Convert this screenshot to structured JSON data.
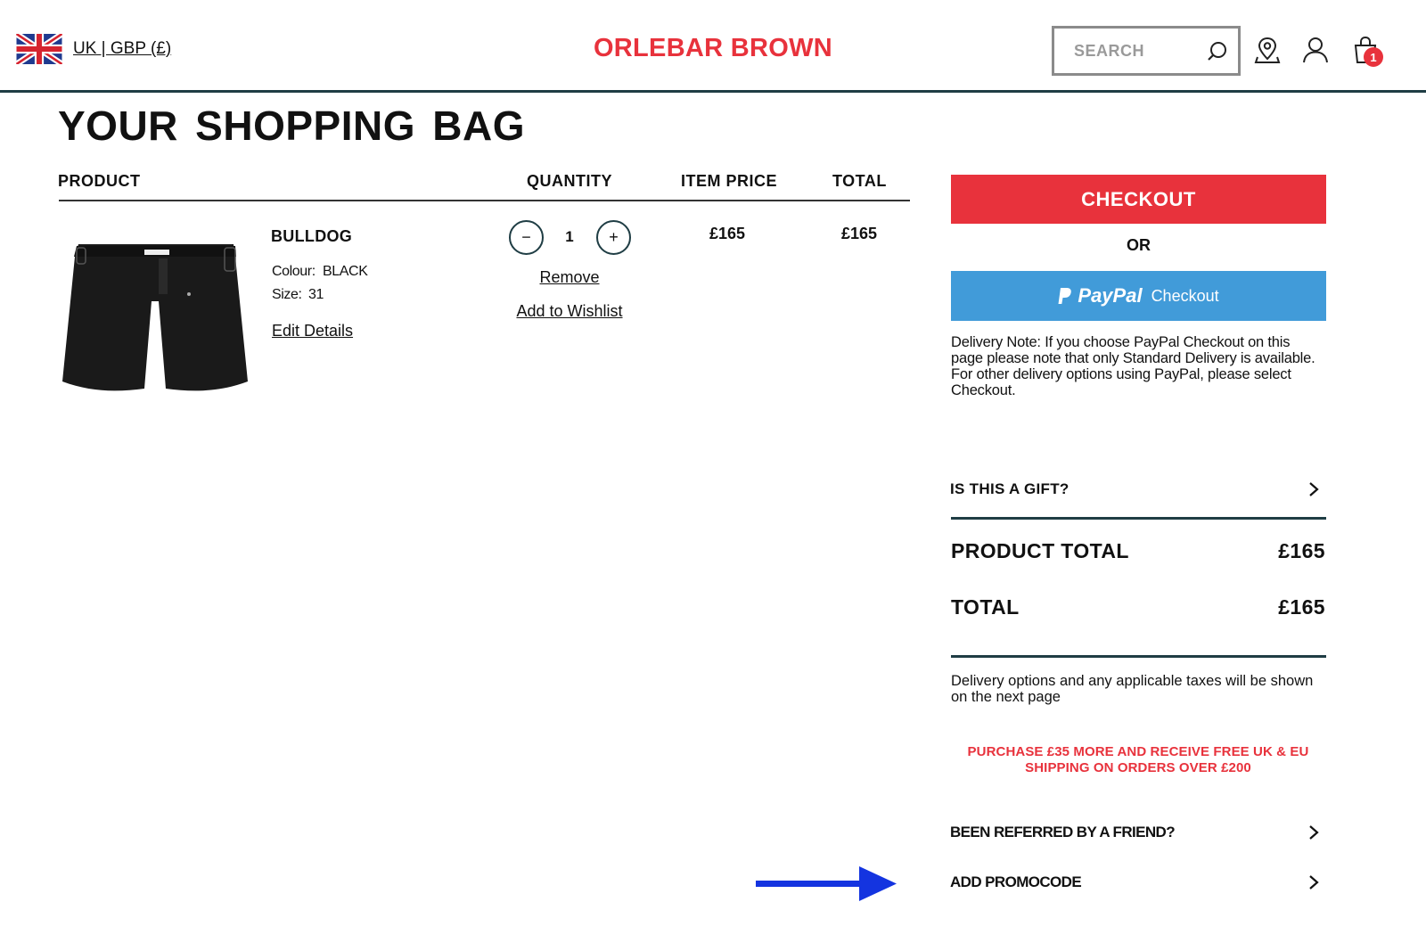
{
  "header": {
    "locale_label": "UK | GBP (£)",
    "brand": "ORLEBAR BROWN",
    "search_placeholder": "SEARCH",
    "bag_count": "1",
    "icons": [
      "uk-flag-icon",
      "search-icon",
      "store-locator-icon",
      "account-icon",
      "shopping-bag-icon"
    ]
  },
  "page": {
    "title": "YOUR SHOPPING BAG"
  },
  "table": {
    "columns": {
      "product": "PRODUCT",
      "quantity": "QUANTITY",
      "item_price": "ITEM PRICE",
      "total": "TOTAL"
    }
  },
  "item": {
    "name": "BULLDOG",
    "colour_label": "Colour:",
    "colour_value": "BLACK",
    "size_label": "Size:",
    "size_value": "31",
    "edit_label": "Edit Details",
    "quantity": "1",
    "decrease_symbol": "−",
    "increase_symbol": "+",
    "remove_label": "Remove",
    "wishlist_label": "Add to Wishlist",
    "item_price": "£165",
    "total": "£165"
  },
  "summary": {
    "checkout_label": "CHECKOUT",
    "or_label": "OR",
    "paypal_brand": "PayPal",
    "paypal_label": "Checkout",
    "delivery_note": "Delivery Note: If you choose PayPal Checkout on this page please note that only Standard Delivery is available. For other delivery options using PayPal, please select Checkout.",
    "gift_label": "IS THIS A GIFT?",
    "product_total_label": "PRODUCT TOTAL",
    "product_total_value": "£165",
    "total_label": "TOTAL",
    "total_value": "£165",
    "delivery_info": "Delivery options and any applicable taxes will be shown on the next page",
    "free_shipping_msg_line1": "PURCHASE £35 MORE AND RECEIVE FREE UK & EU",
    "free_shipping_msg_line2": "SHIPPING ON ORDERS OVER £200",
    "referred_label": "BEEN REFERRED BY A FRIEND?",
    "promo_label": "ADD PROMOCODE"
  },
  "colors": {
    "brand_red": "#e8323c",
    "paypal_blue": "#419bd9",
    "rule_dark": "#1f3d44",
    "annotation_arrow": "#1434e0"
  }
}
